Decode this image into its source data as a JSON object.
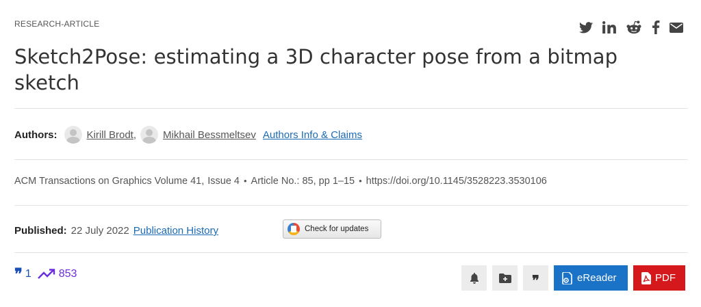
{
  "article_type": "RESEARCH-ARTICLE",
  "share": {
    "icons": [
      "twitter-icon",
      "linkedin-icon",
      "reddit-icon",
      "facebook-icon",
      "email-icon"
    ]
  },
  "title": "Sketch2Pose: estimating a 3D character pose from a bitmap sketch",
  "authors": {
    "label": "Authors:",
    "list": [
      {
        "name": "Kirill Brodt",
        "separator": ","
      },
      {
        "name": "Mikhail Bessmeltsev",
        "separator": ""
      }
    ],
    "info_link": "Authors Info & Claims"
  },
  "citation": {
    "journal": "ACM Transactions on Graphics",
    "volume": "Volume 41,",
    "issue": "Issue 4",
    "article": "Article No.: 85, pp 1–15",
    "doi": "https://doi.org/10.1145/3528223.3530106"
  },
  "published": {
    "label": "Published:",
    "date": "22 July 2022",
    "history_link": "Publication History"
  },
  "updates_button": "Check for updates",
  "metrics": {
    "citations": "1",
    "downloads": "853"
  },
  "actions": {
    "ereader_label": "eReader",
    "pdf_label": "PDF"
  },
  "colors": {
    "link": "#1a6ab5",
    "ereader": "#1a73c7",
    "pdf": "#d4181c",
    "metric": "#6a2ddb"
  }
}
